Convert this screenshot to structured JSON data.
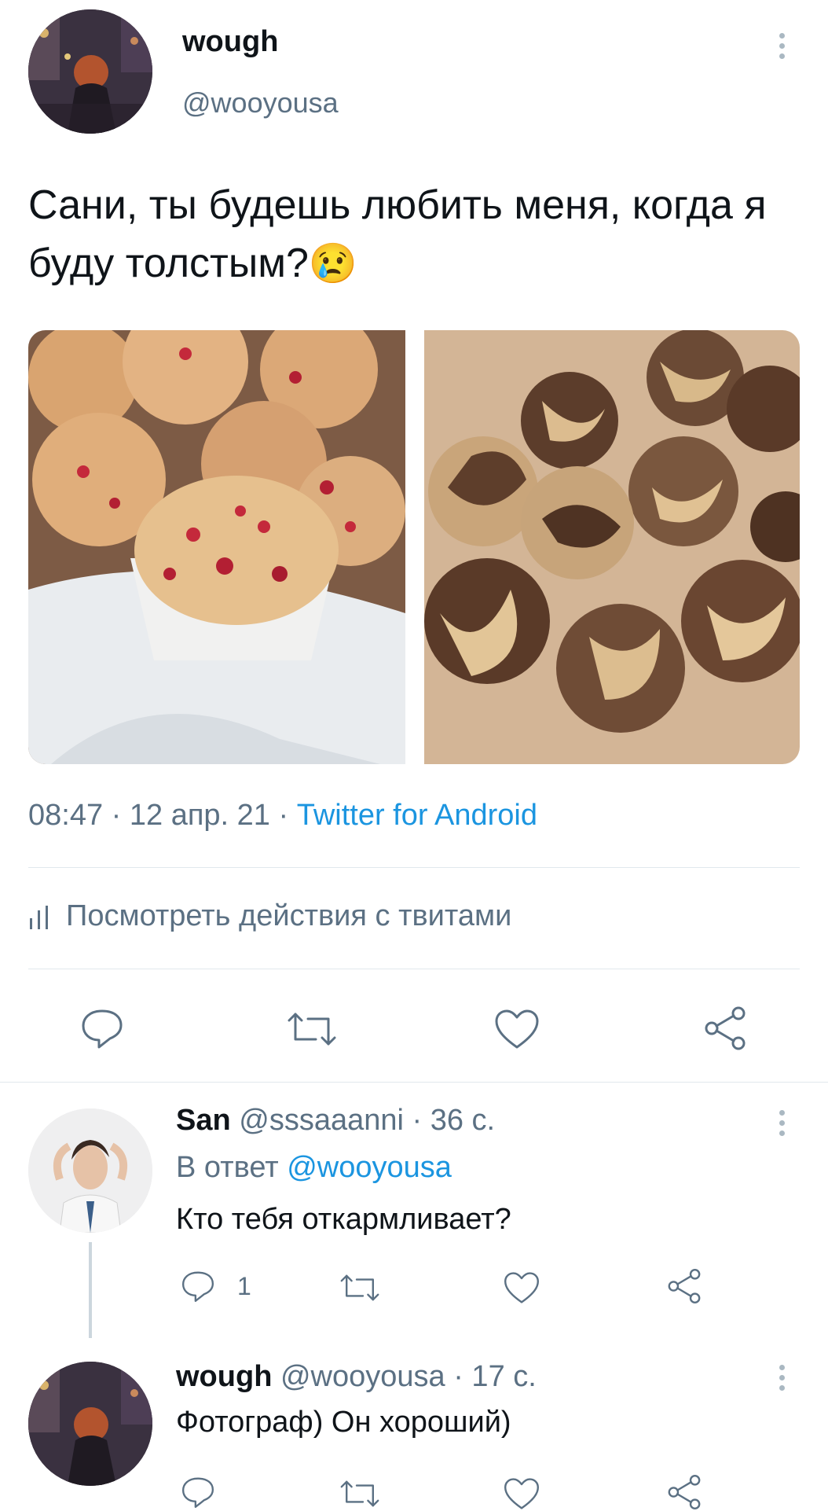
{
  "main_tweet": {
    "display_name": "wough",
    "handle": "@wooyousa",
    "text": "Сани, ты будешь любить меня, когда я буду толстым?",
    "emoji": "😢",
    "time": "08:47",
    "date": "12 апр. 21",
    "separator": "·",
    "source": "Twitter for Android",
    "activity_label": "Посмотреть действия с твитами",
    "images": [
      "cranberry-muffins",
      "marble-muffins"
    ],
    "icons": [
      "reply-icon",
      "retweet-icon",
      "like-icon",
      "share-icon"
    ]
  },
  "replies": [
    {
      "display_name": "San",
      "handle": "@sssaaanni",
      "time": "· 36 с.",
      "in_reply_prefix": "В ответ",
      "in_reply_handle": "@wooyousa",
      "text": "Кто тебя откармливает?",
      "reply_count": "1"
    },
    {
      "display_name": "wough",
      "handle": "@wooyousa",
      "time": "· 17 с.",
      "text": "Фотограф) Он хороший)"
    }
  ],
  "colors": {
    "accent": "#1b95e0",
    "secondary_text": "#5b7083",
    "divider": "#e1e8ed"
  }
}
